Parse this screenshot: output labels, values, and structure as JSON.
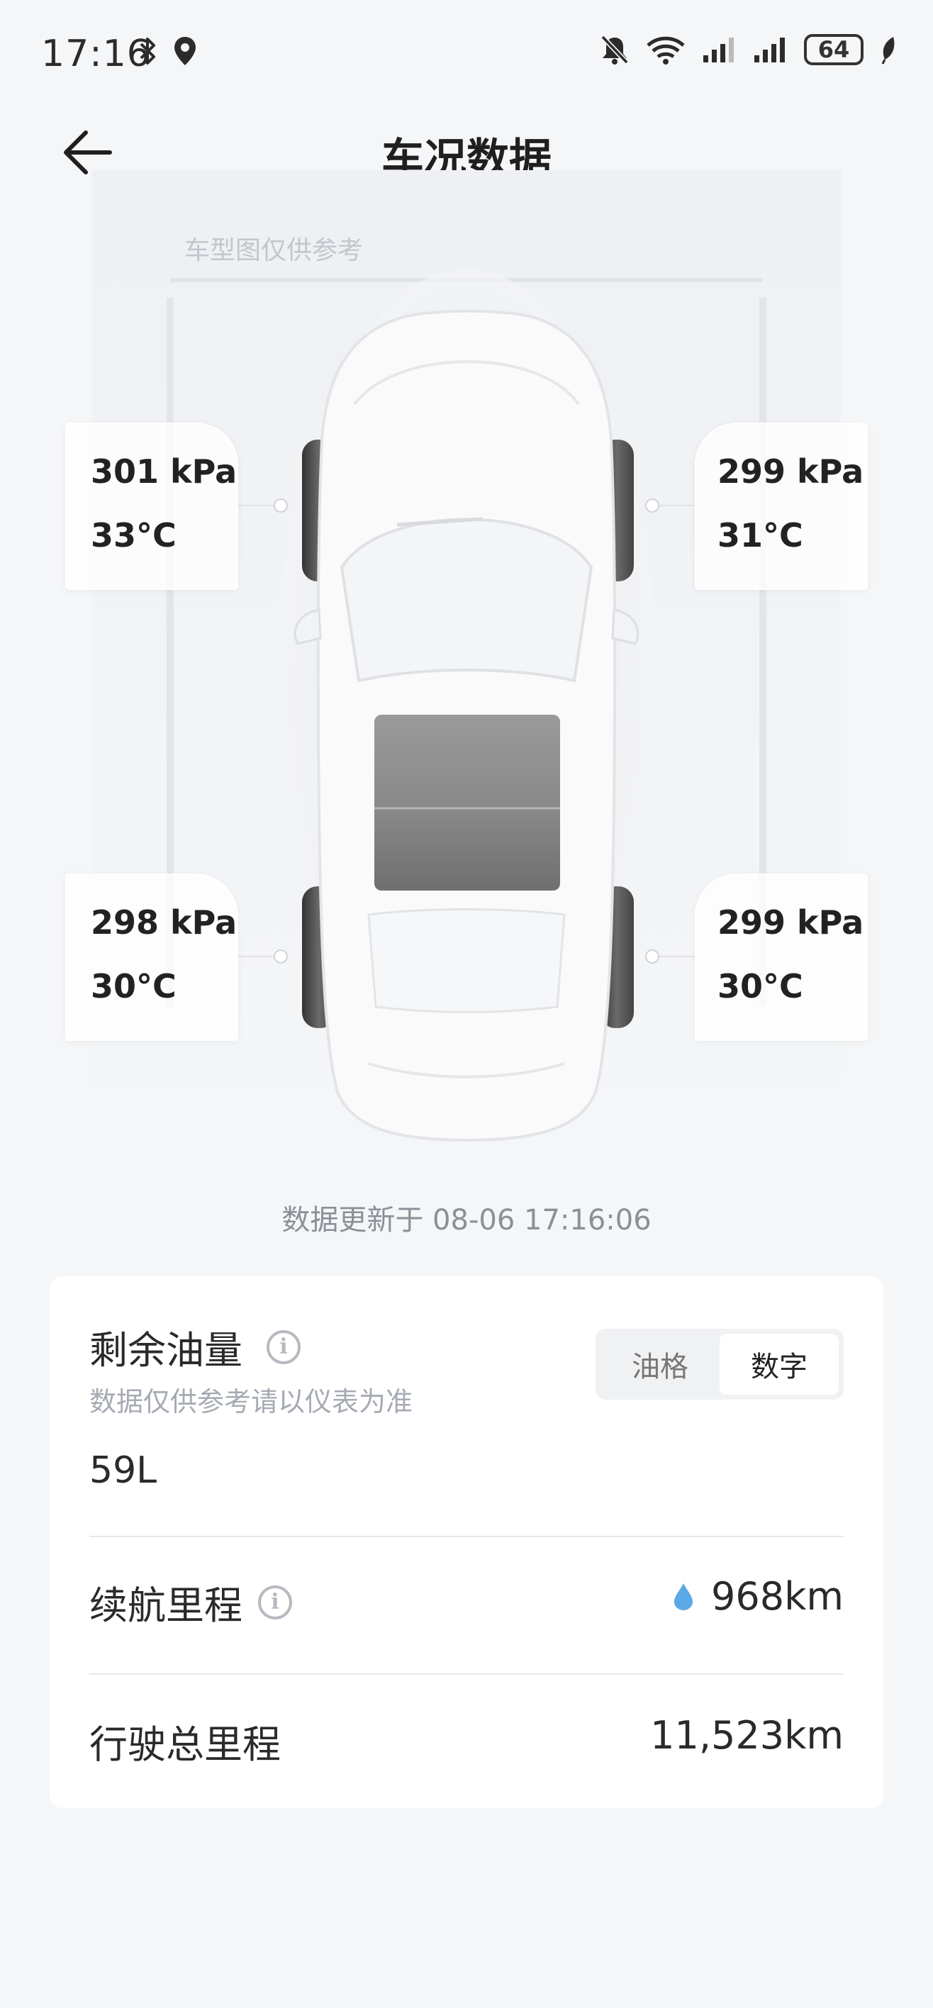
{
  "status_bar": {
    "time": "17:16",
    "battery": "64",
    "icons": [
      "bluetooth-icon",
      "location-icon",
      "mute-icon",
      "wifi-icon",
      "signal-icon",
      "signal-icon",
      "battery-icon",
      "leaf-icon"
    ]
  },
  "header": {
    "title": "车况数据",
    "back_icon": "back-arrow-icon"
  },
  "car": {
    "disclaimer": "车型图仅供参考",
    "tires": {
      "front_left": {
        "pressure": "301 kPa",
        "temp": "33°C"
      },
      "front_right": {
        "pressure": "299 kPa",
        "temp": "31°C"
      },
      "rear_left": {
        "pressure": "298 kPa",
        "temp": "30°C"
      },
      "rear_right": {
        "pressure": "299 kPa",
        "temp": "30°C"
      }
    },
    "updated": "数据更新于 08-06 17:16:06"
  },
  "info": {
    "fuel_label": "剩余油量",
    "fuel_note": "数据仅供参考请以仪表为准",
    "fuel_value": "59L",
    "toggle": {
      "option1": "油格",
      "option2": "数字",
      "selected": "数字"
    },
    "range_label": "续航里程",
    "range_value": "968km",
    "odometer_label": "行驶总里程",
    "odometer_value": "11,523km"
  },
  "colors": {
    "accent_drop": "#5aa9e6",
    "background": "#f5f6f8"
  }
}
